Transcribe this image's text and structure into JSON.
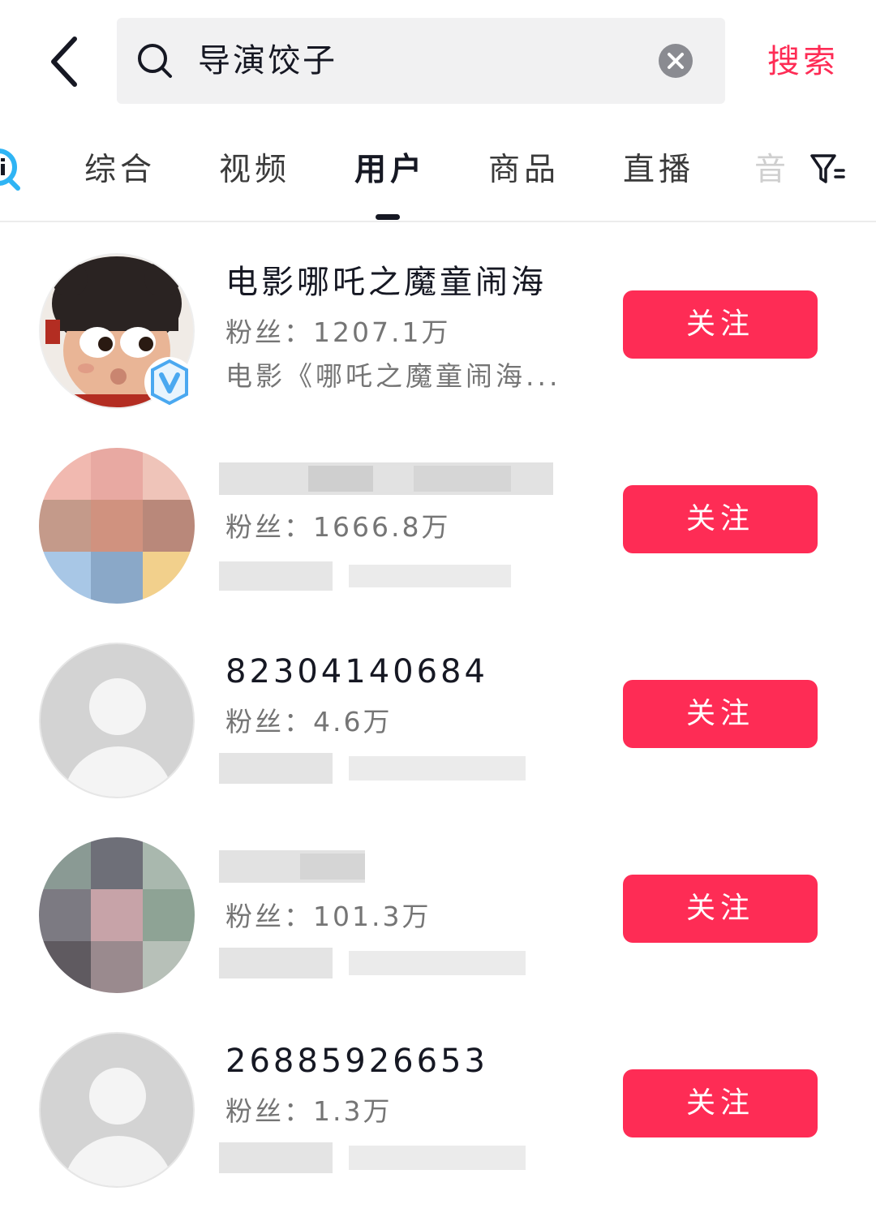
{
  "search": {
    "query": "导演饺子",
    "submit_label": "搜索"
  },
  "tabs": [
    {
      "label": "综合",
      "active": false
    },
    {
      "label": "视频",
      "active": false
    },
    {
      "label": "用户",
      "active": true
    },
    {
      "label": "商品",
      "active": false
    },
    {
      "label": "直播",
      "active": false
    },
    {
      "label": "音",
      "active": false
    }
  ],
  "users": [
    {
      "name": "电影哪吒之魔童闹海",
      "fans": "粉丝：1207.1万",
      "desc": "电影《哪吒之魔童闹海...",
      "verified": true,
      "follow_label": "关注"
    },
    {
      "name": "",
      "fans": "粉丝：1666.8万",
      "desc": "",
      "verified": false,
      "follow_label": "关注"
    },
    {
      "name": "82304140684",
      "fans": "粉丝：4.6万",
      "desc": "",
      "verified": false,
      "follow_label": "关注"
    },
    {
      "name": "",
      "fans": "粉丝：101.3万",
      "desc": "",
      "verified": false,
      "follow_label": "关注"
    },
    {
      "name": "26885926653",
      "fans": "粉丝：1.3万",
      "desc": "",
      "verified": false,
      "follow_label": "关注"
    }
  ],
  "icons": {
    "back": "chevron-left-icon",
    "search": "search-icon",
    "clear": "clear-icon",
    "filter": "filter-icon",
    "verified": "verified-v-icon"
  },
  "colors": {
    "accent": "#fe2c55",
    "verified": "#4aa8f0"
  }
}
